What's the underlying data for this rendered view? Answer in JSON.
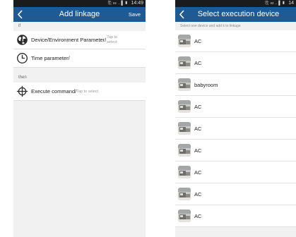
{
  "left_screen": {
    "status": {
      "time": "14:49",
      "icons": "⎘ ☷ .▐ ▮"
    },
    "header": {
      "title": "Add linkage",
      "save_label": "Save"
    },
    "if_label": "if",
    "rows": [
      {
        "label": "Device/Environment Parameter/",
        "hint": "Tap to select"
      },
      {
        "label": "Time parameter/",
        "hint": ""
      }
    ],
    "then_label": "then",
    "execute": {
      "label": "Execute command/",
      "hint": "Tap to select"
    }
  },
  "right_screen": {
    "status": {
      "time": "14",
      "icons": "⎘ ☷ .▐ ▮"
    },
    "header": {
      "title": "Select execution device"
    },
    "hint": "Select one device and add it to linkage",
    "devices": [
      "AC",
      "AC",
      "babyroom",
      "AC",
      "AC",
      "AC",
      "AC",
      "AC",
      "AC"
    ]
  },
  "colors": {
    "appbar": "#1e5a93",
    "statusbar": "#191b1d",
    "background": "#f1f1f1"
  }
}
